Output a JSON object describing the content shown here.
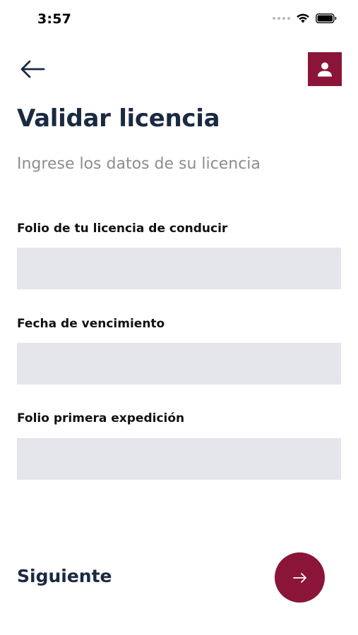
{
  "status_bar": {
    "time": "3:57",
    "icons": [
      "signal-dots-icon",
      "wifi-icon",
      "battery-icon"
    ]
  },
  "header": {
    "back_icon": "arrow-left-icon",
    "profile_icon": "user-icon"
  },
  "title": "Validar licencia",
  "subtitle": "Ingrese los datos de su licencia",
  "fields": [
    {
      "label": "Folio de tu licencia de conducir",
      "value": "",
      "placeholder": ""
    },
    {
      "label": "Fecha de vencimiento",
      "value": "",
      "placeholder": ""
    },
    {
      "label": "Folio primera expedición",
      "value": "",
      "placeholder": ""
    }
  ],
  "footer": {
    "next_label": "Siguiente",
    "next_icon": "arrow-right-icon"
  },
  "colors": {
    "brand": "#8a1538",
    "title": "#1b2a41",
    "subtitle": "#8a8d92",
    "input_bg": "#e4e6ec"
  }
}
